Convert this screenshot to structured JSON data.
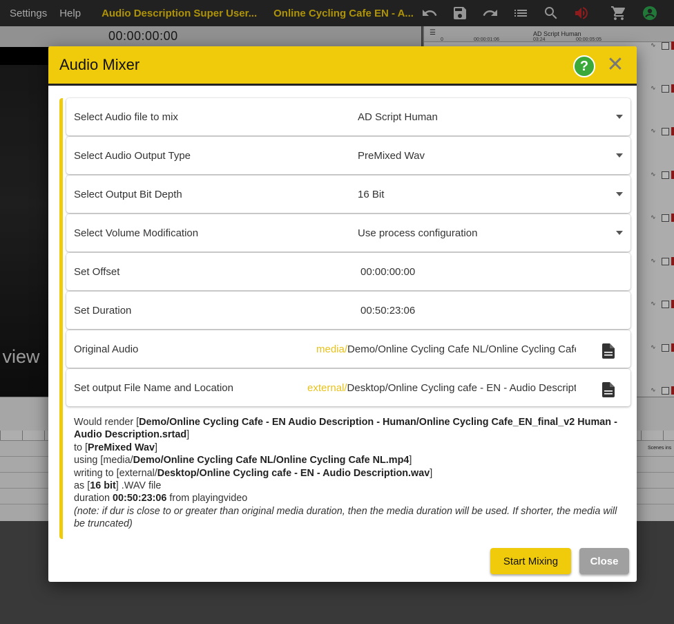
{
  "topbar": {
    "menu": [
      "Settings",
      "Help"
    ],
    "project_title": "Audio Description Super User...",
    "media_title": "Online Cycling Cafe EN - A...",
    "icons": [
      "undo-icon",
      "save-icon",
      "redo-icon",
      "list-icon",
      "search-icon",
      "volume-icon",
      "cart-icon",
      "account-icon"
    ],
    "accent_color": "#f1cc0c",
    "volume_color": "#c62828",
    "account_color": "#2fa84f"
  },
  "background": {
    "timecode": "00:00:00:00",
    "video_overlay_text": "l view",
    "right_panel_title": "AD Script Human",
    "right_panel_header_values": [
      "0",
      "00:00:01:06",
      "03:24",
      "00:00:05:05"
    ],
    "scenes_label": "Scenes ins"
  },
  "dialog": {
    "title": "Audio Mixer",
    "help_label": "?",
    "close_glyph": "✕",
    "accent_color": "#f0cb0b",
    "rows": [
      {
        "label": "Select Audio file to mix",
        "value": "AD Script Human",
        "type": "select"
      },
      {
        "label": "Select Audio Output Type",
        "value": "PreMixed Wav",
        "type": "select"
      },
      {
        "label": "Select Output Bit Depth",
        "value": "16 Bit",
        "type": "select"
      },
      {
        "label": "Select Volume Modification",
        "value": "Use process configuration",
        "type": "select"
      },
      {
        "label": "Set Offset",
        "value": "00:00:00:00",
        "type": "text"
      },
      {
        "label": "Set Duration",
        "value": "00:50:23:06",
        "type": "text"
      }
    ],
    "original_audio": {
      "label": "Original Audio",
      "prefix": "media/",
      "path": "Demo/Online Cycling Cafe NL/Online Cycling Cafe NL.mp4"
    },
    "output_file": {
      "label": "Set output File Name and Location",
      "prefix": "external/",
      "path": "Desktop/Online Cycling cafe - EN - Audio Description.wav"
    },
    "summary": {
      "render_prefix": "Would render [",
      "render_path": "Demo/Online Cycling Cafe - EN Audio Description - Human/Online Cycling Cafe_EN_final_v2 Human - Audio Description.srtad",
      "render_suffix": "]",
      "to_prefix": "to [",
      "to_value": "PreMixed Wav",
      "to_suffix": "]",
      "using_prefix": "using [media/",
      "using_value": "Demo/Online Cycling Cafe NL/Online Cycling Cafe NL.mp4",
      "using_suffix": "]",
      "writing_prefix": "writing to [external/",
      "writing_value": "Desktop/Online Cycling cafe - EN - Audio Description.wav",
      "writing_suffix": "]",
      "as_prefix": "as [",
      "as_value": "16 bit",
      "as_suffix": "] .WAV file",
      "duration_prefix": "duration ",
      "duration_value": "00:50:23:06",
      "duration_suffix": " from playingvideo",
      "note": "(note: if dur is close to or greater than original media duration, then the media duration will be used. If shorter, the media will be truncated)"
    },
    "buttons": {
      "start": "Start Mixing",
      "close": "Close"
    }
  }
}
